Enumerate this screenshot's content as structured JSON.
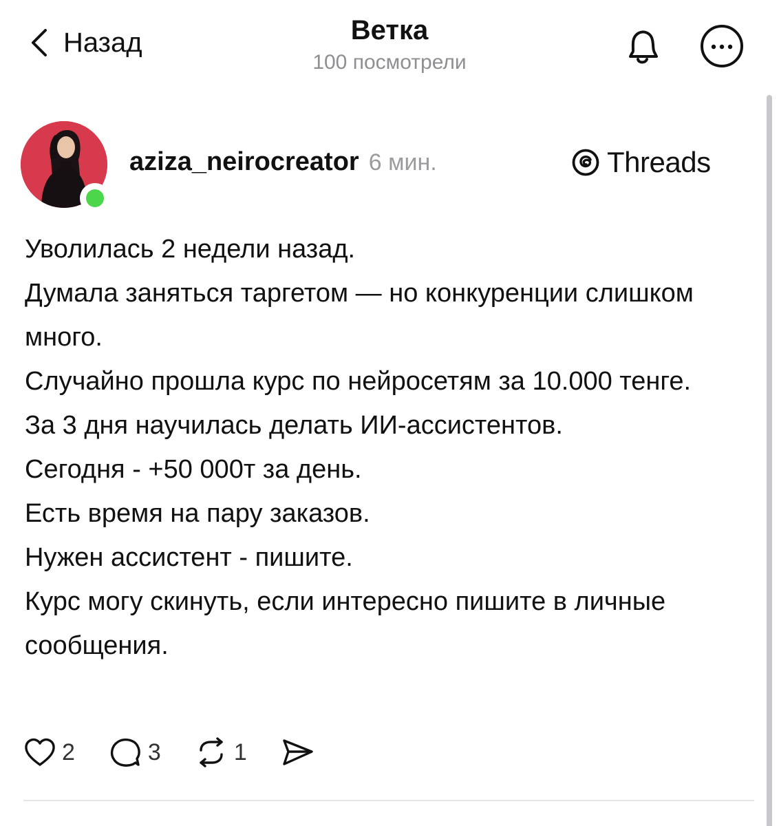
{
  "header": {
    "back_label": "Назад",
    "title": "Ветка",
    "views": "100 посмотрели"
  },
  "post": {
    "username": "aziza_neirocreator",
    "time": "6 мин.",
    "brand": "Threads",
    "online": true,
    "lines": [
      "Уволилась 2 недели назад.",
      "Думала заняться таргетом — но конкуренции слишком много.",
      "Случайно прошла курс по нейросетям за 10.000 тенге.",
      "За 3 дня научилась делать ИИ-ассистентов.",
      "Сегодня - +50 000т за день.",
      "Есть время на пару заказов.",
      "Нужен ассистент - пишите.",
      "Курс могу скинуть, если интересно пишите в личные сообщения."
    ],
    "actions": {
      "likes": "2",
      "comments": "3",
      "reposts": "1"
    }
  },
  "icons": {
    "back": "chevron-left-icon",
    "bell": "bell-icon",
    "more": "more-icon",
    "threads": "threads-logo-icon",
    "like": "heart-icon",
    "comment": "comment-icon",
    "repost": "repost-icon",
    "share": "share-icon"
  },
  "colors": {
    "text": "#111111",
    "muted": "#8e8e93",
    "online": "#4cd64c",
    "avatar_bg": "#d63a4c"
  }
}
